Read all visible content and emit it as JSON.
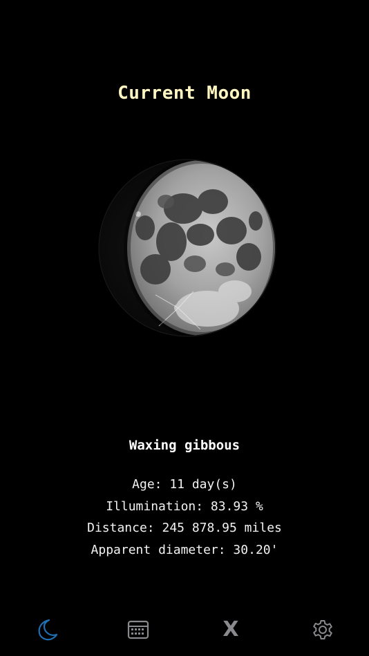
{
  "header": {
    "title": "Current Moon"
  },
  "moon": {
    "phase_name": "Waxing gibbous",
    "illumination_fraction": 0.8393
  },
  "info": {
    "age": "Age: 11 day(s)",
    "illumination": "Illumination: 83.93 %",
    "distance": "Distance: 245 878.95 miles",
    "apparent_diameter": "Apparent diameter: 30.20'"
  },
  "tabbar": {
    "items": [
      {
        "icon": "moon-icon",
        "active": true
      },
      {
        "icon": "calendar-icon",
        "active": false
      },
      {
        "icon": "x-icon",
        "glyph": "X",
        "active": false
      },
      {
        "icon": "gear-icon",
        "active": false
      }
    ]
  },
  "colors": {
    "background": "#000000",
    "title": "#fff6c2",
    "text": "#ffffff",
    "tab_active": "#1f6fb2",
    "tab_inactive": "#8a8a8e"
  }
}
